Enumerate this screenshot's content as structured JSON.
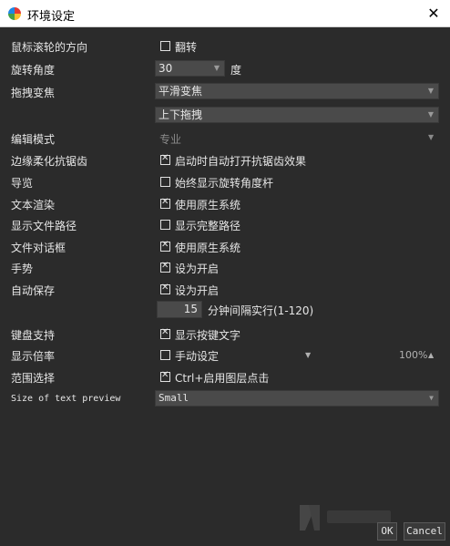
{
  "window": {
    "title": "环境设定",
    "close_glyph": "✕"
  },
  "rows": {
    "scroll_direction": {
      "label": "鼠标滚轮的方向",
      "option": "翻转",
      "checked": false
    },
    "rotation_angle": {
      "label": "旋转角度",
      "value": "30",
      "unit": "度"
    },
    "drag_zoom": {
      "label": "拖拽变焦",
      "value1": "平滑变焦",
      "value2": "上下拖拽"
    },
    "edit_mode": {
      "label": "编辑模式",
      "value": "专业"
    },
    "antialias": {
      "label": "边缘柔化抗锯齿",
      "option": "启动时自动打开抗锯齿效果",
      "checked": true
    },
    "navigation": {
      "label": "导览",
      "option": "始终显示旋转角度杆",
      "checked": false
    },
    "text_render": {
      "label": "文本渲染",
      "option": "使用原生系统",
      "checked": true
    },
    "file_path": {
      "label": "显示文件路径",
      "option": "显示完整路径",
      "checked": false
    },
    "file_dialog": {
      "label": "文件对话框",
      "option": "使用原生系统",
      "checked": true
    },
    "gesture": {
      "label": "手势",
      "option": "设为开启",
      "checked": true
    },
    "autosave": {
      "label": "自动保存",
      "option": "设为开启",
      "checked": true,
      "interval": "15",
      "interval_text": "分钟间隔实行(1-120)"
    },
    "keyboard": {
      "label": "键盘支持",
      "option": "显示按键文字",
      "checked": true
    },
    "zoom_ratio": {
      "label": "显示倍率",
      "option": "手动设定",
      "checked": false,
      "value": "100%"
    },
    "range_select": {
      "label": "范围选择",
      "option": "Ctrl+启用图层点击",
      "checked": true
    },
    "text_preview": {
      "label": "Size of text preview",
      "value": "Small"
    }
  },
  "buttons": {
    "ok": "OK",
    "cancel": "Cancel"
  },
  "icons": {
    "combo_arrow": "▼",
    "spin_up": "▲"
  }
}
